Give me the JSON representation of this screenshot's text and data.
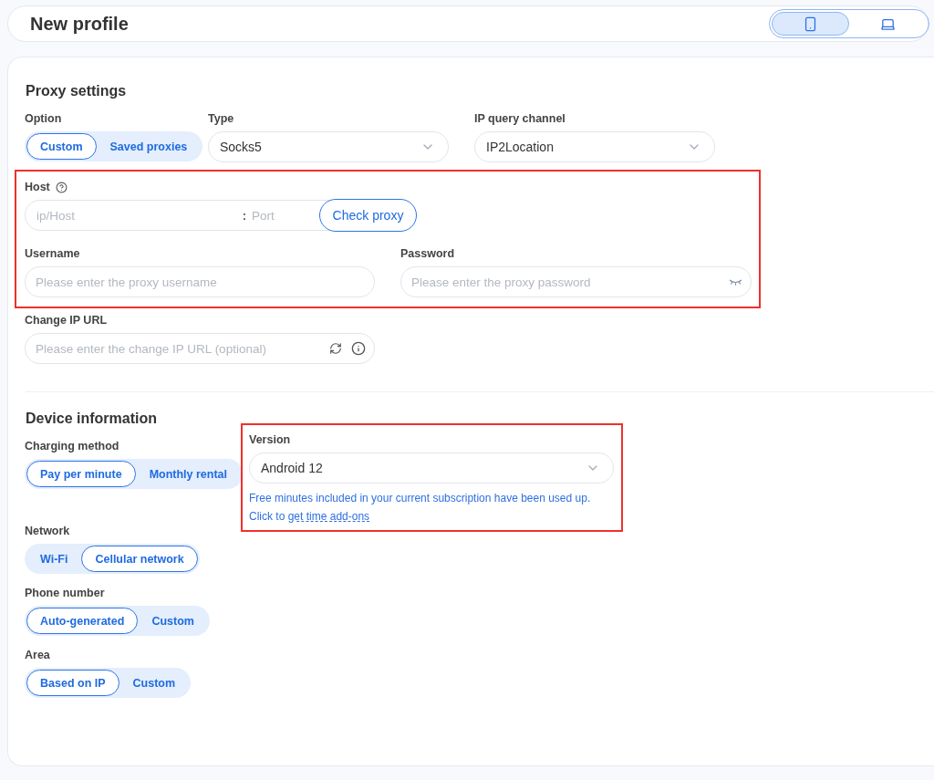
{
  "header": {
    "title": "New profile",
    "device_toggle": [
      {
        "kind": "phone",
        "selected": true
      },
      {
        "kind": "laptop",
        "selected": false
      }
    ]
  },
  "proxy": {
    "title": "Proxy settings",
    "option": {
      "label": "Option",
      "choices": [
        {
          "label": "Custom",
          "selected": true
        },
        {
          "label": "Saved proxies",
          "selected": false
        }
      ]
    },
    "type": {
      "label": "Type",
      "value": "Socks5"
    },
    "ip_channel": {
      "label": "IP query channel",
      "value": "IP2Location"
    },
    "credentials_highlighted": true,
    "host": {
      "label": "Host",
      "host_placeholder": "ip/Host",
      "separator": ":",
      "port_placeholder": "Port",
      "button": "Check proxy"
    },
    "username": {
      "label": "Username",
      "placeholder": "Please enter the proxy username"
    },
    "password": {
      "label": "Password",
      "placeholder": "Please enter the proxy password"
    },
    "change_ip_url": {
      "label": "Change IP URL",
      "placeholder": "Please enter the change IP URL (optional)"
    }
  },
  "device": {
    "title": "Device information",
    "charging": {
      "label": "Charging method",
      "choices": [
        {
          "label": "Pay per minute",
          "selected": true
        },
        {
          "label": "Monthly rental",
          "selected": false
        }
      ]
    },
    "version": {
      "label": "Version",
      "value": "Android 12",
      "highlighted": true,
      "notice": "Free minutes included in your current subscription have been used up. Click to",
      "link": "get time add-ons"
    },
    "network": {
      "label": "Network",
      "choices": [
        {
          "label": "Wi-Fi",
          "selected": false
        },
        {
          "label": "Cellular network",
          "selected": true
        }
      ]
    },
    "phone_number": {
      "label": "Phone number",
      "choices": [
        {
          "label": "Auto-generated",
          "selected": true
        },
        {
          "label": "Custom",
          "selected": false
        }
      ]
    },
    "area": {
      "label": "Area",
      "choices": [
        {
          "label": "Based on IP",
          "selected": true
        },
        {
          "label": "Custom",
          "selected": false
        }
      ]
    }
  }
}
